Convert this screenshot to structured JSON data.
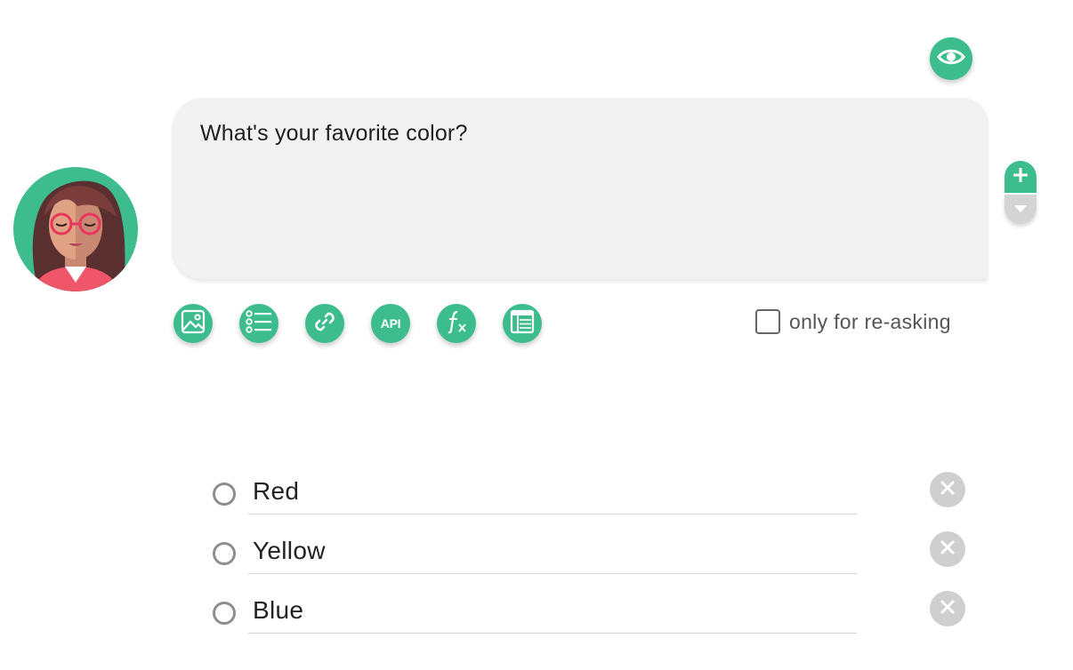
{
  "header": {
    "preview_icon": "eye-icon",
    "accent_color": "#3dbd8d"
  },
  "avatar": {
    "icon": "avatar-woman-glasses"
  },
  "question": {
    "text": "What's your favorite color?"
  },
  "side_controls": {
    "add_icon": "plus-icon",
    "collapse_icon": "triangle-down-icon"
  },
  "toolbar": {
    "tools": [
      {
        "name": "image",
        "icon": "image-icon"
      },
      {
        "name": "list",
        "icon": "list-icon"
      },
      {
        "name": "link",
        "icon": "link-icon"
      },
      {
        "name": "api",
        "label": "API"
      },
      {
        "name": "formula",
        "icon": "function-icon"
      },
      {
        "name": "table",
        "icon": "table-icon"
      }
    ],
    "reask_label": "only for re-asking",
    "reask_checked": false
  },
  "options": [
    {
      "label": "Red"
    },
    {
      "label": "Yellow"
    },
    {
      "label": "Blue"
    }
  ]
}
